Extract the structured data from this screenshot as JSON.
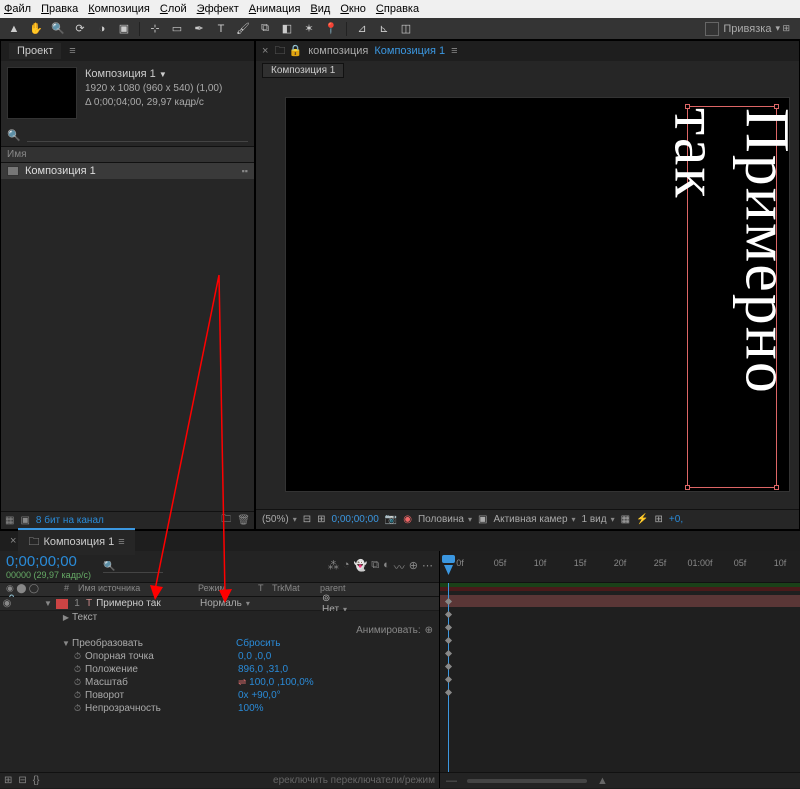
{
  "menu": {
    "items": [
      "Файл",
      "Правка",
      "Композиция",
      "Слой",
      "Эффект",
      "Анимация",
      "Вид",
      "Окно",
      "Справка"
    ]
  },
  "toolbar": {
    "snap_label": "Привязка"
  },
  "project": {
    "tab": "Проект",
    "comp_name": "Композиция 1",
    "res": "1920 x 1080  (960 x 540) (1,00)",
    "dur": "Δ 0;00;04;00, 29,97 кадр/с",
    "list_head": "Имя",
    "item": "Композиция 1",
    "bpc": "8 бит на канал"
  },
  "composer": {
    "prefix": "композиция",
    "crumb": "Композиция 1",
    "subtab": "Композиция 1",
    "preview_text": "Примерно так"
  },
  "viewer_footer": {
    "zoom": "(50%)",
    "time": "0;00;00;00",
    "quality": "Половина",
    "camera": "Активная камер",
    "views": "1 вид"
  },
  "timeline": {
    "tab": "Композиция 1",
    "timecode": "0;00;00;00",
    "fps": "00000 (29,97 кадр/с)",
    "ruler": [
      "0f",
      "05f",
      "10f",
      "15f",
      "20f",
      "25f",
      "01:00f",
      "05f",
      "10f"
    ],
    "col": {
      "num": "#",
      "name": "Имя источника",
      "mode": "Режим",
      "trk": "T",
      "trkm": "TrkMat",
      "par": "parent"
    },
    "layer": {
      "num": "1",
      "name": "Примерно так",
      "mode": "Нормаль",
      "par": "Нет"
    },
    "groups": {
      "text": "Текст",
      "transform": "Преобразовать",
      "reset": "Сбросить",
      "animate": "Анимировать:"
    },
    "props": {
      "anchor": {
        "label": "Опорная точка",
        "value": "0,0 ,0,0"
      },
      "position": {
        "label": "Положение",
        "value": "896,0 ,31,0"
      },
      "scale": {
        "label": "Масштаб",
        "value": "100,0 ,100,0%"
      },
      "rotation": {
        "label": "Поворот",
        "value": "0x +90,0°"
      },
      "opacity": {
        "label": "Непрозрачность",
        "value": "100%"
      }
    },
    "footer_hint": "ереключить переключатели/режим"
  }
}
